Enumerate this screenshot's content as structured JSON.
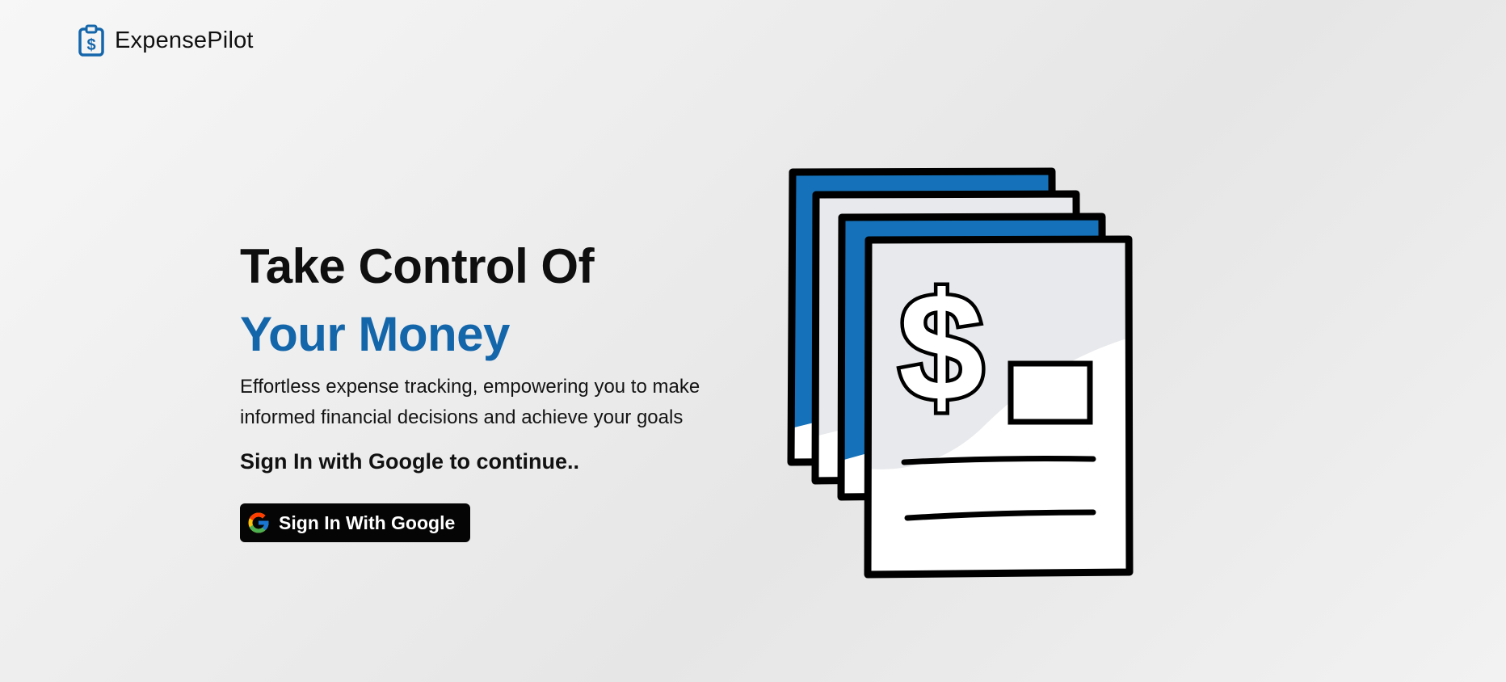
{
  "brand": {
    "name": "ExpensePilot",
    "icon": "clipboard-dollar-icon",
    "accent_color": "#1466ab"
  },
  "hero": {
    "headline_line1": "Take Control Of",
    "headline_line2": "Your Money",
    "tagline": "Effortless expense tracking, empowering you to make informed financial decisions and achieve your goals",
    "cta_text": "Sign In with Google to continue..",
    "signin_button_label": "Sign In With Google",
    "signin_button_icon": "google-icon",
    "button_color": "#050505"
  },
  "illustration": {
    "icon": "expense-documents-illustration",
    "symbol": "$"
  }
}
